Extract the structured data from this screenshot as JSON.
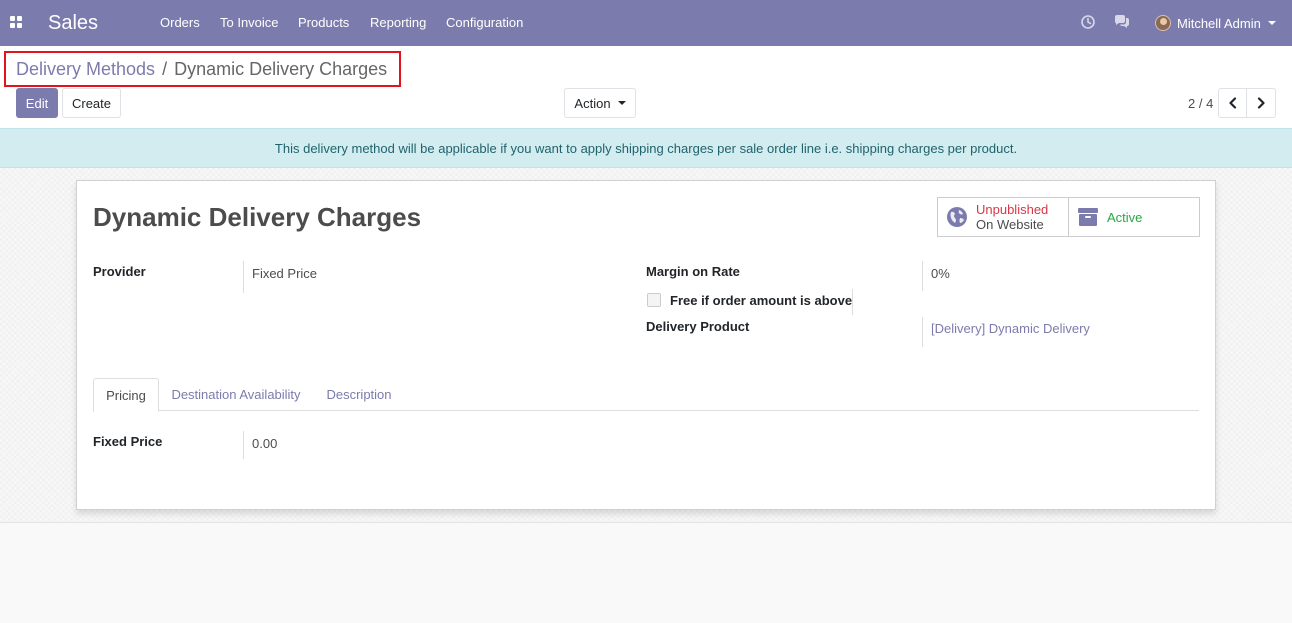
{
  "navbar": {
    "app_name": "Sales",
    "menu": [
      "Orders",
      "To Invoice",
      "Products",
      "Reporting",
      "Configuration"
    ],
    "user_name": "Mitchell Admin",
    "icons": [
      "apps-icon",
      "clock-icon",
      "chat-icon"
    ],
    "color": "#7c7bad"
  },
  "breadcrumb": {
    "parent": "Delivery Methods",
    "separator": "/",
    "current": "Dynamic Delivery Charges"
  },
  "toolbar": {
    "edit_label": "Edit",
    "create_label": "Create",
    "action_label": "Action"
  },
  "pager": {
    "value": "2 / 4"
  },
  "alert": {
    "text": "This delivery method will be applicable if you want to apply shipping charges per sale order line i.e. shipping charges per product."
  },
  "record": {
    "title": "Dynamic Delivery Charges",
    "publish": {
      "line1": "Unpublished",
      "line2": "On Website",
      "color": "#dc3545"
    },
    "active": {
      "label": "Active",
      "color": "#28a745"
    },
    "fields": {
      "provider_label": "Provider",
      "provider_value": "Fixed Price",
      "margin_label": "Margin on Rate",
      "margin_value": "0%",
      "free_label": "Free if order amount is above",
      "free_checked": false,
      "product_label": "Delivery Product",
      "product_value": "[Delivery] Dynamic Delivery"
    },
    "tabs": [
      "Pricing",
      "Destination Availability",
      "Description"
    ],
    "active_tab": "Pricing",
    "pricing": {
      "fixed_price_label": "Fixed Price",
      "fixed_price_value": "0.00"
    }
  }
}
